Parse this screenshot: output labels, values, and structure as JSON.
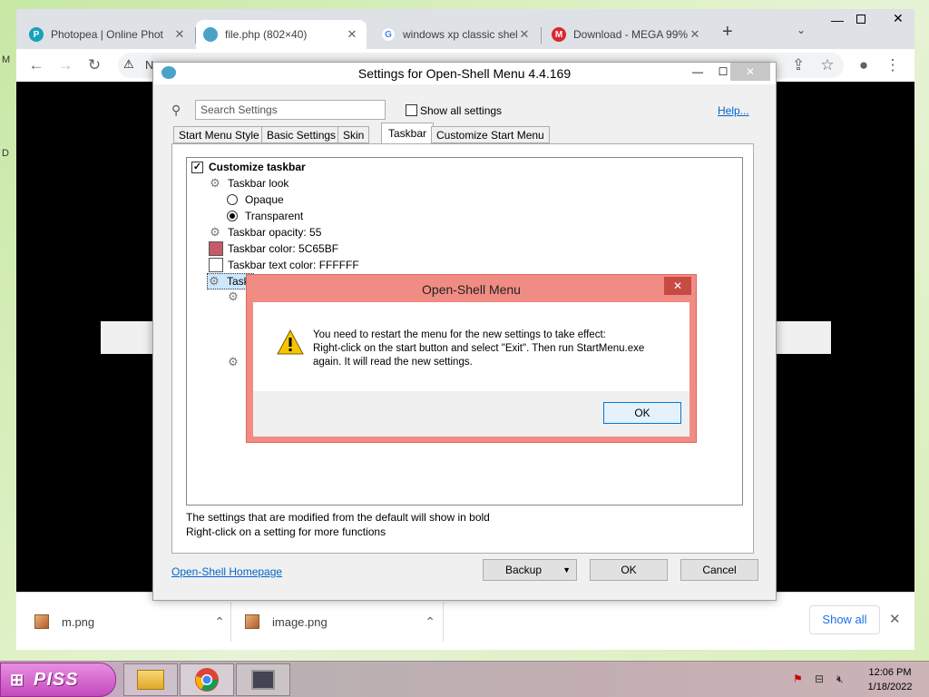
{
  "browser": {
    "tabs": [
      {
        "title": "Photopea | Online Phot",
        "favicon_color": "#17a2b8",
        "favicon": "photopea-icon"
      },
      {
        "title": "file.php (802×40)",
        "favicon_color": "#4aa3c7",
        "favicon": "openshell-icon"
      },
      {
        "title": "windows xp classic shel",
        "favicon_color": "#4285f4",
        "favicon": "google-icon"
      },
      {
        "title": "Download - MEGA 99%",
        "favicon_color": "#d9272e",
        "favicon": "mega-icon"
      }
    ],
    "new_tab": "+",
    "omnibox_prefix": "N",
    "downloads": {
      "items": [
        {
          "name": "m.png"
        },
        {
          "name": "image.png"
        }
      ],
      "show_all": "Show all"
    }
  },
  "settings": {
    "title": "Settings for Open-Shell Menu 4.4.169",
    "search_placeholder": "Search Settings",
    "show_all_label": "Show all settings",
    "help_link": "Help...",
    "tabs": [
      "Start Menu Style",
      "Basic Settings",
      "Skin",
      "Taskbar",
      "Customize Start Menu"
    ],
    "selected_tab": "Taskbar",
    "tree": {
      "customize_taskbar": "Customize taskbar",
      "taskbar_look": "Taskbar look",
      "opaque": "Opaque",
      "transparent": "Transparent",
      "opacity": "Taskbar opacity: 55",
      "color": "Taskbar color: 5C65BF",
      "color_hex": "#c55c65",
      "text_color": "Taskbar text color: FFFFFF",
      "text_color_hex": "#FFFFFF",
      "partial": "Task"
    },
    "hint1": "The settings that are modified from the default will show in bold",
    "hint2": "Right-click on a setting for more functions",
    "homepage_link": "Open-Shell Homepage",
    "backup": "Backup",
    "ok": "OK",
    "cancel": "Cancel"
  },
  "dialog": {
    "title": "Open-Shell Menu",
    "line1": "You need to restart the menu for the new settings to take effect:",
    "line2": "Right-click on the start button and select \"Exit\". Then run StartMenu.exe",
    "line3": "again. It will read the new settings.",
    "ok": "OK"
  },
  "taskbar": {
    "start_label": "PISS",
    "time": "12:06 PM",
    "date": "1/18/2022"
  }
}
